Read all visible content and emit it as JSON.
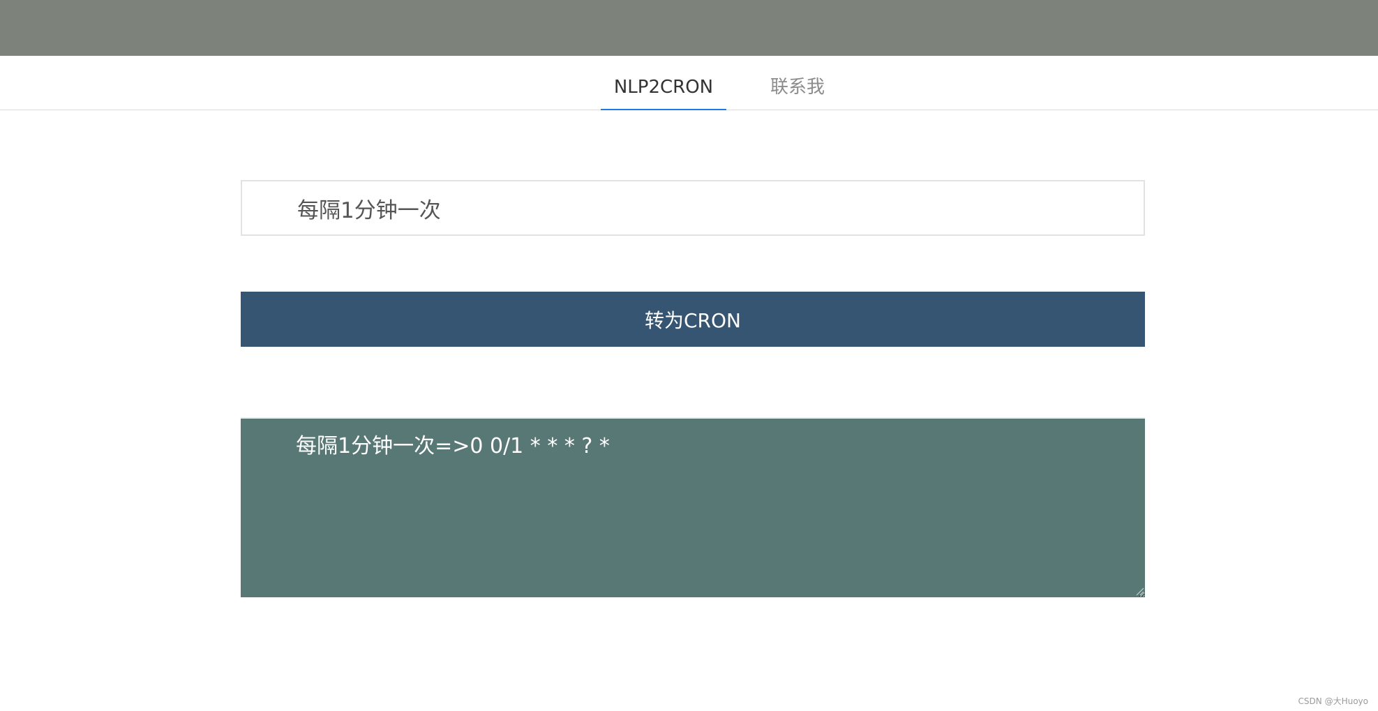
{
  "tabs": [
    {
      "label": "NLP2CRON",
      "active": true
    },
    {
      "label": "联系我",
      "active": false
    }
  ],
  "input": {
    "value": "每隔1分钟一次"
  },
  "convert_button": {
    "label": "转为CRON"
  },
  "output": {
    "value": "每隔1分钟一次=>0 0/1 * * * ? *"
  },
  "watermark": "CSDN @大Huoyo",
  "colors": {
    "top_bar": "#7d837b",
    "accent": "#1e7ae0",
    "button": "#365573",
    "output_bg": "#587876"
  }
}
